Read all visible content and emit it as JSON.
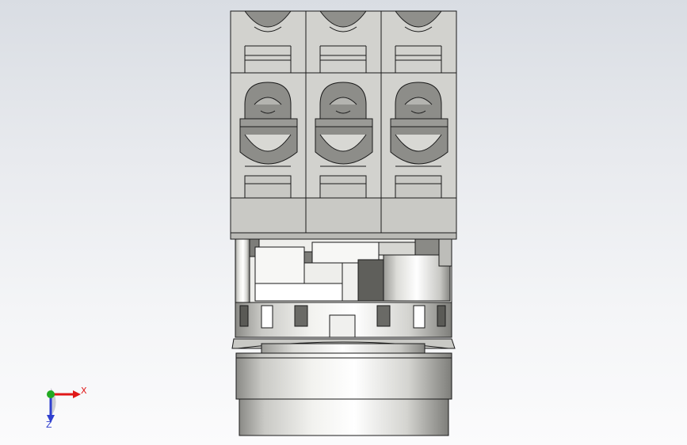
{
  "viewport": {
    "background_top": "#d9dde3",
    "background_bottom": "#fbfbfc",
    "model": {
      "description_icon": "cad-part-icon",
      "body_color": "#d6d6d2",
      "shade_color": "#8c8c88",
      "edge_color": "#1a1a1a",
      "terminal_count": 3
    }
  },
  "triad": {
    "x_label": "X",
    "z_label": "Z",
    "x_color": "#e01818",
    "z_color": "#2f3fcf",
    "origin_color": "#22aa22"
  }
}
